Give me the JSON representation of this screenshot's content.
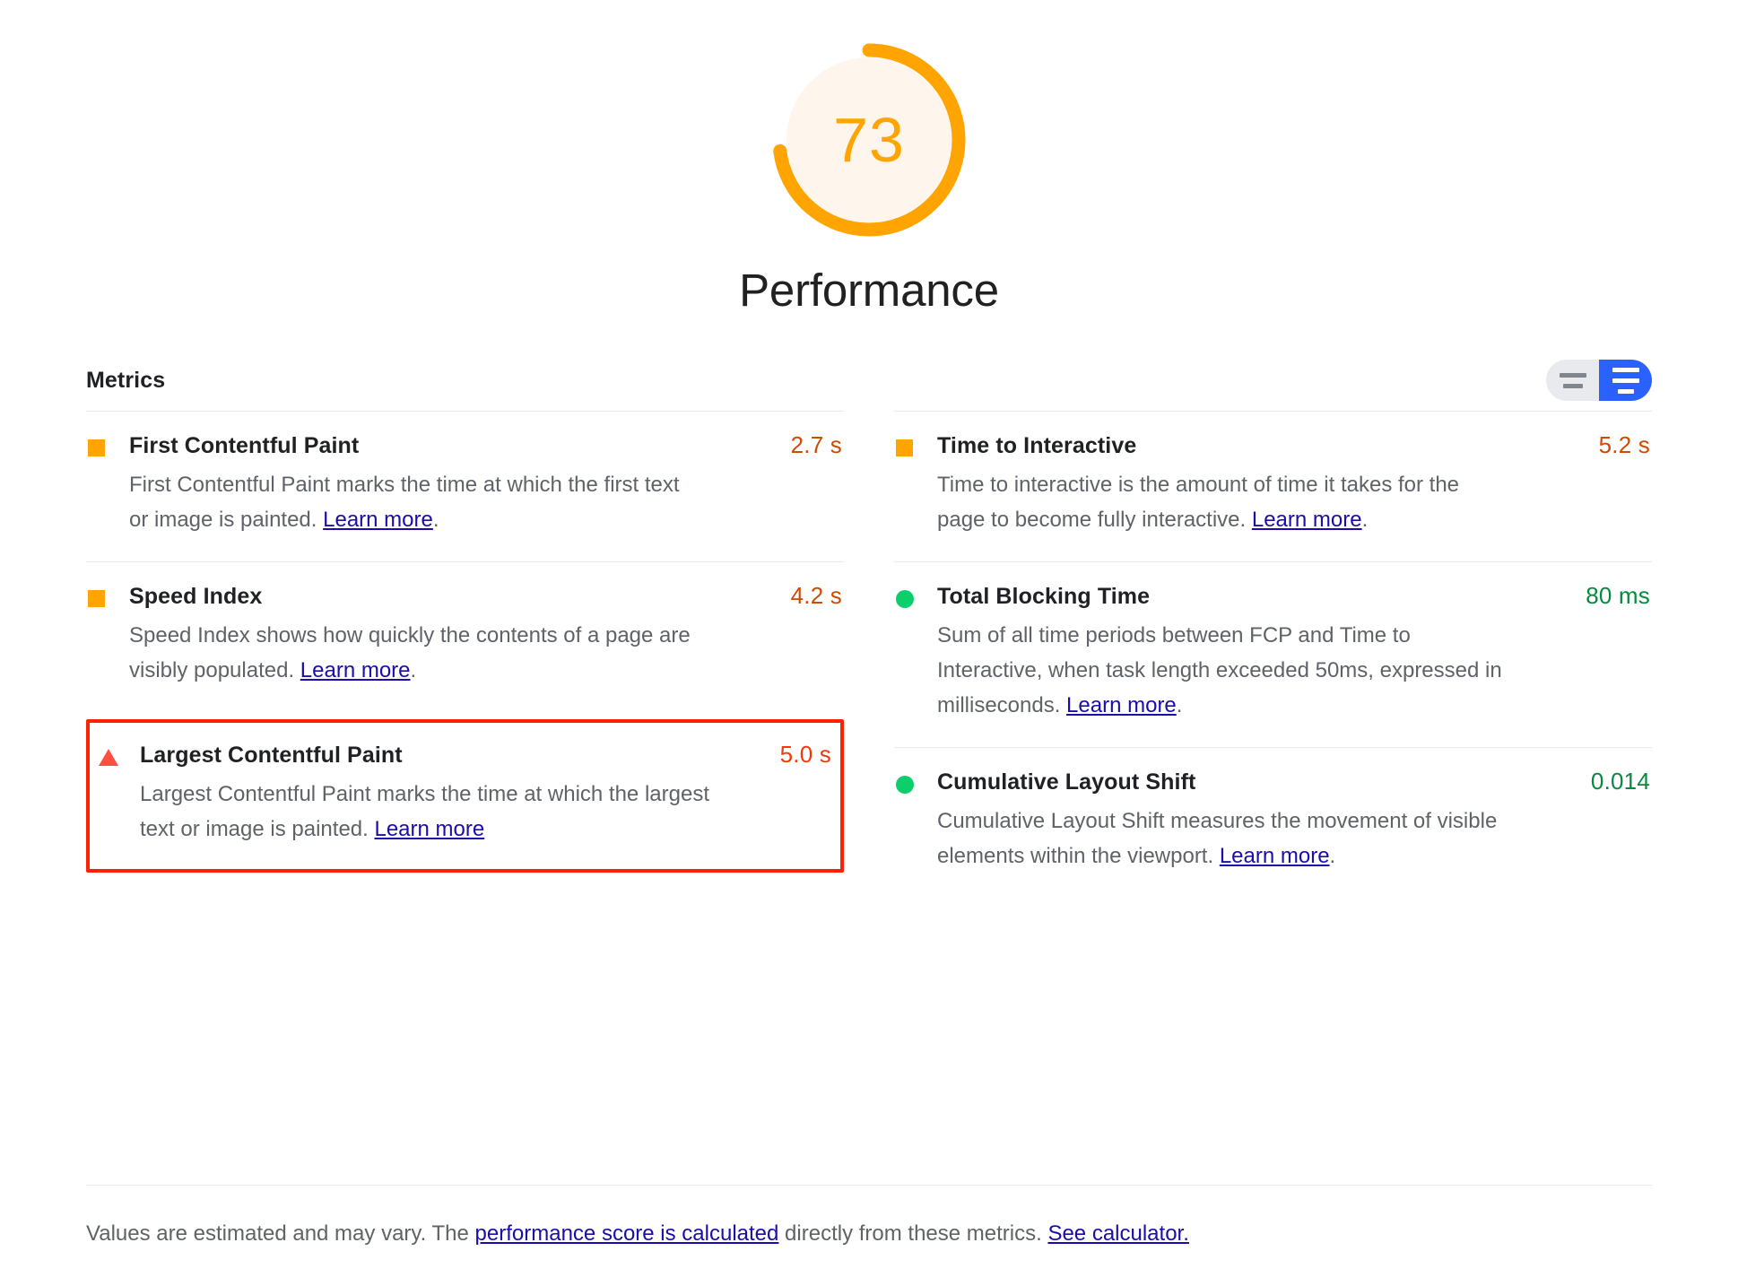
{
  "gauge": {
    "score": "73",
    "score_value": 73,
    "category_title": "Performance",
    "arc_color": "#FFA400",
    "fill_color": "#FEF6EC"
  },
  "metrics_section": {
    "title": "Metrics",
    "toggle": {
      "collapsed_label": "collapsed-view",
      "expanded_label": "expanded-view",
      "active": "expanded",
      "inactive_color": "#e8eaed",
      "active_color": "#2A61FF"
    }
  },
  "metrics": {
    "left_column": [
      {
        "name": "First Contentful Paint",
        "value": "2.7 s",
        "status": "average",
        "icon": "square-icon",
        "icon_color": "#FFA400",
        "value_color": "#D04A02",
        "description_before": "First Contentful Paint marks the time at which the first text or image is painted. ",
        "link_text": "Learn more",
        "description_after": ".",
        "highlighted": false
      },
      {
        "name": "Speed Index",
        "value": "4.2 s",
        "status": "average",
        "icon": "square-icon",
        "icon_color": "#FFA400",
        "value_color": "#D04A02",
        "description_before": "Speed Index shows how quickly the contents of a page are visibly populated. ",
        "link_text": "Learn more",
        "description_after": ".",
        "highlighted": false
      },
      {
        "name": "Largest Contentful Paint",
        "value": "5.0 s",
        "status": "fail",
        "icon": "triangle-warning-icon",
        "icon_color": "#FF4E42",
        "value_color": "#F03A0E",
        "description_before": "Largest Contentful Paint marks the time at which the largest text or image is painted. ",
        "link_text": "Learn more",
        "description_after": "",
        "highlighted": true,
        "highlight_color": "#FF2200"
      }
    ],
    "right_column": [
      {
        "name": "Time to Interactive",
        "value": "5.2 s",
        "status": "average",
        "icon": "square-icon",
        "icon_color": "#FFA400",
        "value_color": "#D04A02",
        "description_before": "Time to interactive is the amount of time it takes for the page to become fully interactive. ",
        "link_text": "Learn more",
        "description_after": ".",
        "highlighted": false
      },
      {
        "name": "Total Blocking Time",
        "value": "80 ms",
        "status": "pass",
        "icon": "circle-icon",
        "icon_color": "#0CCE6B",
        "value_color": "#078A40",
        "description_before": "Sum of all time periods between FCP and Time to Interactive, when task length exceeded 50ms, expressed in milliseconds. ",
        "link_text": "Learn more",
        "description_after": ".",
        "highlighted": false
      },
      {
        "name": "Cumulative Layout Shift",
        "value": "0.014",
        "status": "pass",
        "icon": "circle-icon",
        "icon_color": "#0CCE6B",
        "value_color": "#078A40",
        "description_before": "Cumulative Layout Shift measures the movement of visible elements within the viewport. ",
        "link_text": "Learn more",
        "description_after": ".",
        "highlighted": false
      }
    ]
  },
  "footer": {
    "text_1": "Values are estimated and may vary. The ",
    "link_1": "performance score is calculated",
    "text_2": " directly from these metrics. ",
    "link_2": "See calculator."
  }
}
